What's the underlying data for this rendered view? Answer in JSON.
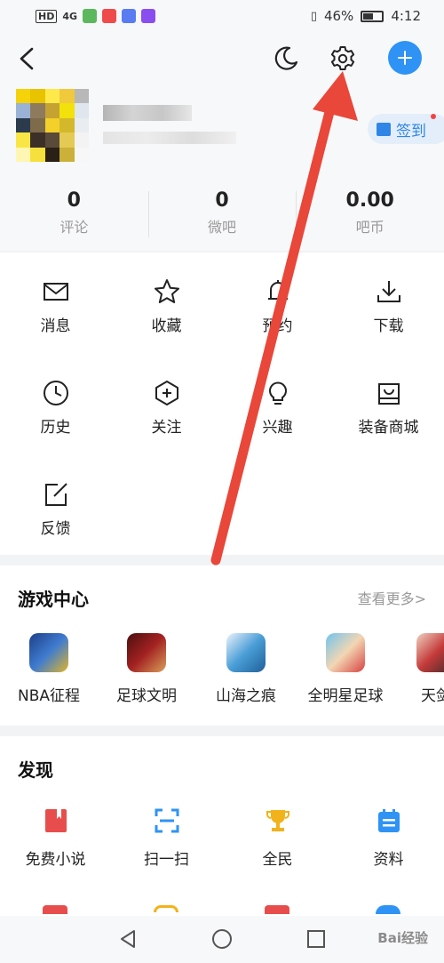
{
  "status_bar": {
    "left_text": "HD",
    "net": "4G",
    "battery_pct": "46%",
    "time": "4:12",
    "app_chip_colors": [
      "#5cb85c",
      "#f04b4b",
      "#5a7cf2",
      "#8a4df0"
    ]
  },
  "header": {
    "back_icon": "chevron-left-icon",
    "moon_icon": "moon-icon",
    "gear_icon": "gear-icon",
    "add_icon": "plus-icon",
    "signin_label": "签到",
    "avatar_colors": [
      "#f5d20a",
      "#e7c300",
      "#ffe94a",
      "#f0c93c",
      "#b8b8b8",
      "#9ab2d6",
      "#8e7a5c",
      "#c6a232",
      "#f2e10b",
      "#dfe6ee",
      "#2b3a4d",
      "#7d6b4a",
      "#f4d02b",
      "#d4b82b",
      "#e9ecf0",
      "#f9e646",
      "#3c2f28",
      "#5a4a3a",
      "#e4ca52",
      "#f3f3f3",
      "#fff6b3",
      "#f6e03e",
      "#2a2018",
      "#cbb13a",
      "#f7f7f7"
    ],
    "stats": [
      {
        "value": "0",
        "label": "评论"
      },
      {
        "value": "0",
        "label": "微吧"
      },
      {
        "value": "0.00",
        "label": "吧币"
      }
    ]
  },
  "grid": [
    {
      "label": "消息",
      "icon": "mail-icon"
    },
    {
      "label": "收藏",
      "icon": "star-icon"
    },
    {
      "label": "预约",
      "icon": "alarm-icon"
    },
    {
      "label": "下载",
      "icon": "download-icon"
    },
    {
      "label": "历史",
      "icon": "clock-icon"
    },
    {
      "label": "关注",
      "icon": "hexagon-plus-icon"
    },
    {
      "label": "兴趣",
      "icon": "lightbulb-icon"
    },
    {
      "label": "装备商城",
      "icon": "shopping-bag-icon"
    },
    {
      "label": "反馈",
      "icon": "edit-icon"
    }
  ],
  "game_center": {
    "title": "游戏中心",
    "see_more": "查看更多>",
    "games": [
      {
        "name": "NBA征程",
        "color": "#2f5aa8"
      },
      {
        "name": "足球文明",
        "color": "#7a1a1a"
      },
      {
        "name": "山海之痕",
        "color": "#4a9ed6"
      },
      {
        "name": "全明星足球",
        "color": "#d84141"
      },
      {
        "name": "天剑",
        "color": "#c43a3a"
      }
    ]
  },
  "discover": {
    "title": "发现",
    "items": [
      {
        "label": "免费小说",
        "icon": "book-icon",
        "color": "#e84d4d"
      },
      {
        "label": "扫一扫",
        "icon": "scan-icon",
        "color": "#2f93f5"
      },
      {
        "label": "全民",
        "icon": "trophy-icon",
        "color": "#f2b21b"
      },
      {
        "label": "资料",
        "icon": "calendar-icon",
        "color": "#2f93f5"
      }
    ],
    "peek_colors": [
      "#e84d4d",
      "#f2b21b",
      "#e84d4d",
      "#2f93f5"
    ]
  },
  "navbar": {
    "back_icon": "triangle-back-icon",
    "home_icon": "circle-home-icon",
    "recent_icon": "square-recent-icon",
    "watermark": "Bai经验"
  },
  "annotation": {
    "color": "#e8473a"
  }
}
